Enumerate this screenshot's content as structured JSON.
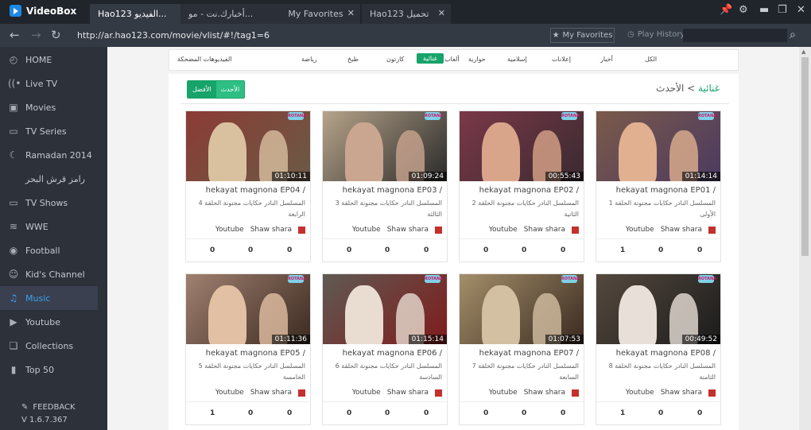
{
  "app": {
    "name": "VideoBox"
  },
  "tabs": [
    {
      "label": "Hao123 الفيديو..."
    },
    {
      "label": "أخبارك.نت - مو..."
    },
    {
      "label": "My Favorites"
    },
    {
      "label": "Hao123 تحميل"
    }
  ],
  "address": {
    "url": "http://ar.hao123.com/movie/vlist/#!/tag1=6",
    "favorites_label": "My Favorites",
    "history_label": "Play History",
    "search_placeholder": ""
  },
  "sidebar": {
    "items": [
      {
        "label": "HOME",
        "icon": "gauge-icon"
      },
      {
        "label": "Live TV",
        "icon": "signal-icon"
      },
      {
        "label": "Movies",
        "icon": "film-icon"
      },
      {
        "label": "TV Series",
        "icon": "tv-icon"
      },
      {
        "label": "Ramadan 2014",
        "icon": "moon-icon"
      },
      {
        "label": "رامز قرش البحر",
        "icon": ""
      },
      {
        "label": "TV Shows",
        "icon": "tv-icon"
      },
      {
        "label": "WWE",
        "icon": "wwe-icon"
      },
      {
        "label": "Football",
        "icon": "ball-icon"
      },
      {
        "label": "Kid's Channel",
        "icon": "kid-icon"
      },
      {
        "label": "Music",
        "icon": "music-icon",
        "active": true
      },
      {
        "label": "Youtube",
        "icon": "play-icon"
      },
      {
        "label": "Collections",
        "icon": "collections-icon"
      },
      {
        "label": "Top 50",
        "icon": "bars-icon"
      }
    ],
    "feedback_label": "FEEDBACK",
    "version": "V  1.6.7.367"
  },
  "categories": [
    "الكل",
    "أخبار",
    "إعلانات",
    "إسلامية",
    "حوارية",
    "ألعاب",
    "غنائية",
    "كارتون",
    "طبخ",
    "رياضة",
    "الفيديوهات المضحكة"
  ],
  "active_category": "غنائية",
  "sort_buttons": [
    "الأفضل",
    "الأحدث"
  ],
  "breadcrumb": {
    "parent": "غنائية",
    "sep": " > ",
    "current": "الأحدث"
  },
  "videos": [
    {
      "title": "hekayat magnona EP01 /",
      "desc": "المسلسل النادر حكايات مجنونة الحلقة 1 الأولى",
      "duration": "01:14:14",
      "source": "Shaw shara",
      "channel": "Youtube",
      "stats": [
        "1",
        "0",
        "0"
      ]
    },
    {
      "title": "hekayat magnona EP02 /",
      "desc": "المسلسل النادر حكايات مجنونة الحلقة 2 الثانية",
      "duration": "00:55:43",
      "source": "Shaw shara",
      "channel": "Youtube",
      "stats": [
        "0",
        "0",
        "0"
      ]
    },
    {
      "title": "hekayat magnona EP03 /",
      "desc": "المسلسل النادر حكايات مجنونة الحلقة 3 الثالثة",
      "duration": "01:09:24",
      "source": "Shaw shara",
      "channel": "Youtube",
      "stats": [
        "0",
        "0",
        "0"
      ]
    },
    {
      "title": "hekayat magnona EP04 /",
      "desc": "المسلسل النادر حكايات مجنونة الحلقة 4 الرابعة",
      "duration": "01:10:11",
      "source": "Shaw shara",
      "channel": "Youtube",
      "stats": [
        "0",
        "0",
        "0"
      ]
    },
    {
      "title": "hekayat magnona EP08 /",
      "desc": "المسلسل النادر حكايات مجنونة الحلقة 8 الثامنة",
      "duration": "00:49:52",
      "source": "Shaw shara",
      "channel": "Youtube",
      "stats": [
        "1",
        "0",
        "0"
      ]
    },
    {
      "title": "hekayat magnona EP07 /",
      "desc": "المسلسل النادر حكايات مجنونة الحلقة 7 السابعة",
      "duration": "01:07:53",
      "source": "Shaw shara",
      "channel": "Youtube",
      "stats": [
        "0",
        "0",
        "0"
      ]
    },
    {
      "title": "hekayat magnona EP06 /",
      "desc": "المسلسل النادر حكايات مجنونة الحلقة 6 السادسة",
      "duration": "01:15:14",
      "source": "Shaw shara",
      "channel": "Youtube",
      "stats": [
        "0",
        "0",
        "0"
      ]
    },
    {
      "title": "hekayat magnona EP05 /",
      "desc": "المسلسل النادر حكايات مجنونة الحلقة 5 الخامسة",
      "duration": "01:11:36",
      "source": "Shaw shara",
      "channel": "Youtube",
      "stats": [
        "1",
        "0",
        "0"
      ]
    }
  ],
  "colors": {
    "accent": "#18a36b",
    "sidebar_bg": "#2c313a",
    "active_blue": "#3d9fea"
  }
}
